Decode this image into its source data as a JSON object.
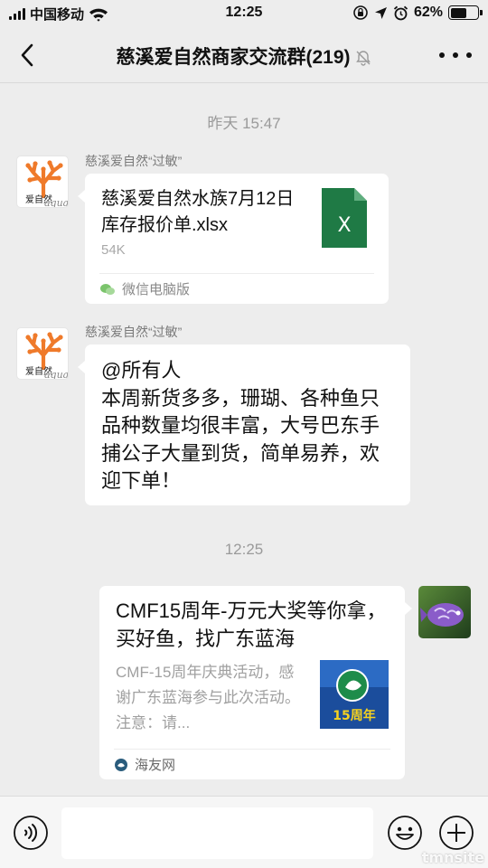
{
  "status_bar": {
    "carrier": "中国移动",
    "time": "12:25",
    "battery_pct": "62%",
    "battery_level": 0.62
  },
  "header": {
    "title": "慈溪爱自然商家交流群(219)",
    "icons": [
      "back-chevron-icon",
      "mute-bell-icon",
      "more-dots-icon"
    ]
  },
  "chat": {
    "time_1": "昨天 15:47",
    "msg_file": {
      "sender": "慈溪爱自然“过敏”",
      "avatar_text": "爱自然",
      "avatar_script": "aqua",
      "file_name": "慈溪爱自然水族7月12日库存报价单.xlsx",
      "file_size": "54K",
      "file_icon_letter": "X",
      "source": "微信电脑版"
    },
    "msg_text": {
      "sender": "慈溪爱自然“过敏”",
      "avatar_text": "爱自然",
      "avatar_script": "aqua",
      "text": "@所有人\n本周新货多多，珊瑚、各种鱼只品种数量均很丰富，大号巴东手捕公子大量到货，简单易养，欢迎下单！"
    },
    "time_2": "12:25",
    "msg_link": {
      "title": "CMF15周年-万元大奖等你拿，买好鱼，找广东蓝海",
      "desc": "CMF-15周年庆典活动，感谢广东蓝海参与此次活动。注意：请...",
      "thumb_text": "15周年",
      "source": "海友网"
    }
  },
  "input": {
    "placeholder": "",
    "watermark": "tmnsite"
  },
  "colors": {
    "bg": "#ededed",
    "excel_green": "#1f7a45",
    "coral": "#ef7a2a"
  }
}
